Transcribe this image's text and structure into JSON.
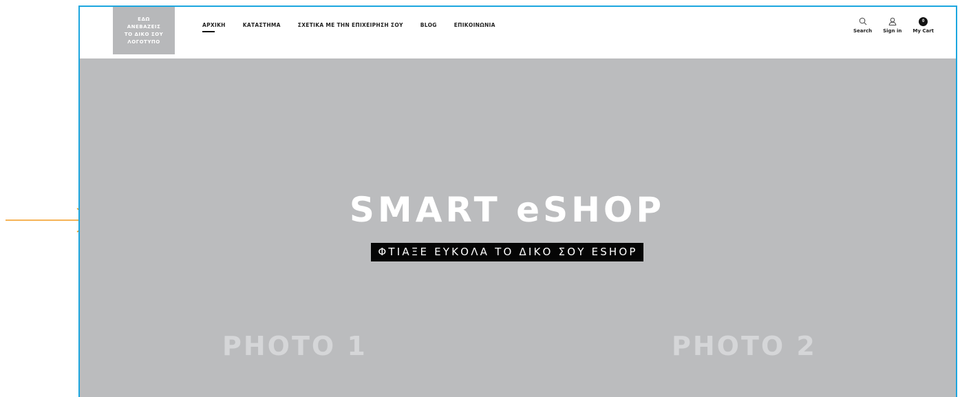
{
  "logo": {
    "lines": [
      "ΕΔΩ",
      "ΑΝΕΒΑΖΕΙΣ",
      "ΤΟ ΔΙΚΟ ΣΟΥ",
      "ΛΟΓΟΤΥΠΟ"
    ]
  },
  "nav": {
    "items": [
      {
        "label": "ΑΡΧΙΚΗ",
        "active": true
      },
      {
        "label": "ΚΑΤΑΣΤΗΜΑ"
      },
      {
        "label": "ΣΧΕΤΙΚΑ ΜΕ ΤΗΝ ΕΠΙΧΕΙΡΗΣΗ ΣΟΥ"
      },
      {
        "label": "BLOG"
      },
      {
        "label": "ΕΠΙΚΟΙΝΩΝΙΑ"
      }
    ]
  },
  "tools": {
    "search_label": "Search",
    "signin_label": "Sign in",
    "cart_label": "My Cart",
    "cart_count": "0",
    "search_icon": "search-icon",
    "user_icon": "user-icon"
  },
  "hero": {
    "title": "SMART eSHOP",
    "subtitle": "ΦΤΙΑΞΕ ΕΥΚΟΛΑ ΤΟ ΔΙΚΟ ΣΟΥ ESHOP",
    "photo_1": "PHOTO 1",
    "photo_2": "PHOTO 2"
  },
  "colors": {
    "frame_border": "#1ba6df",
    "arrow": "#f39a1e",
    "hero_background": "#bbbcbe",
    "logo_background": "#b7b8ba"
  }
}
